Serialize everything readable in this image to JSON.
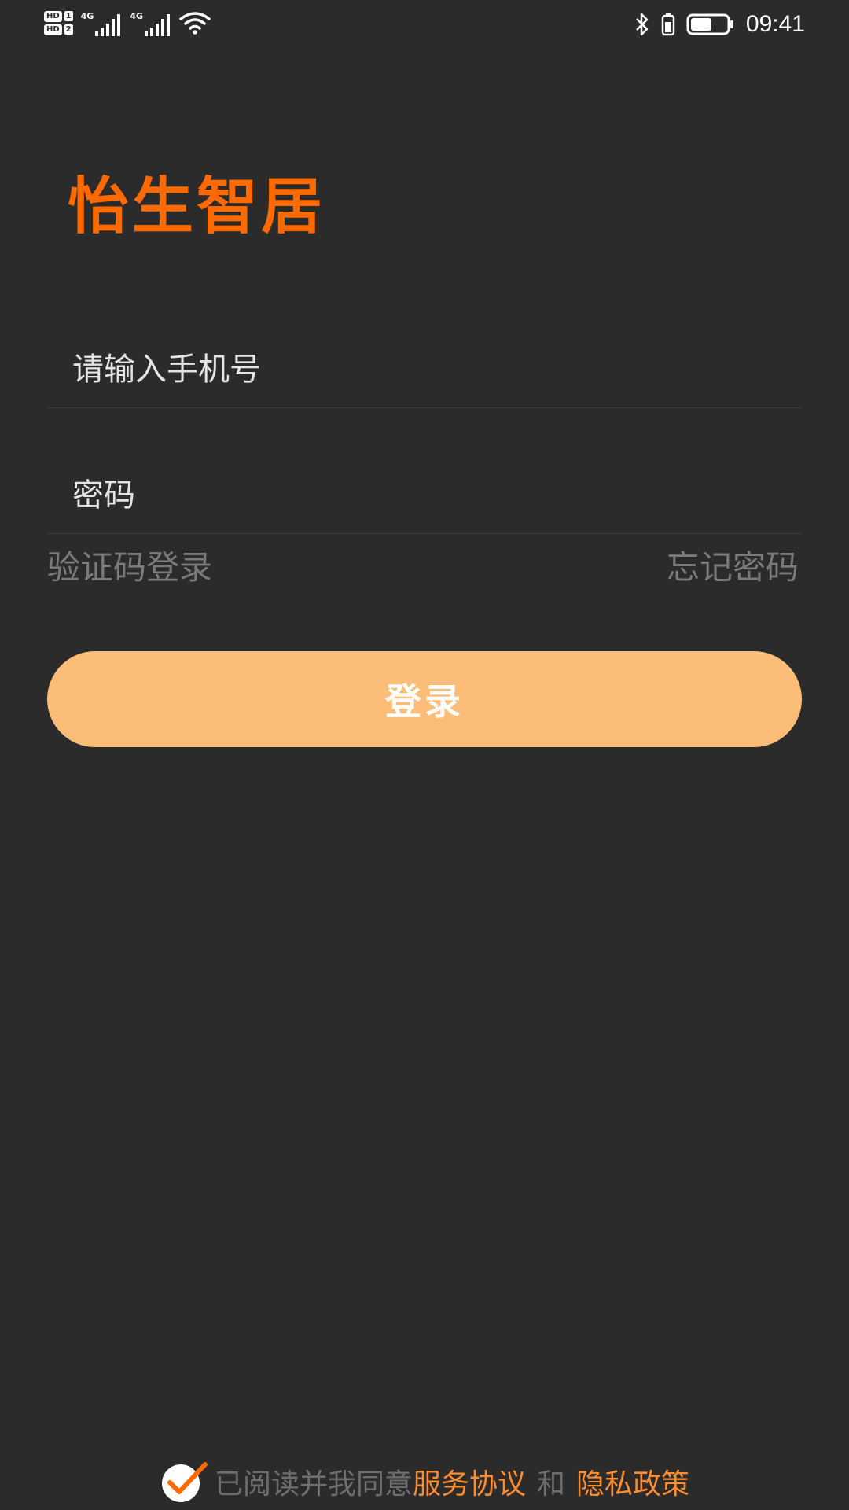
{
  "status_bar": {
    "sim1_badge": "HD",
    "sim1_num": "1",
    "sim2_badge": "HD",
    "sim2_num": "2",
    "net1_label": "4G",
    "net2_label": "4G",
    "time": "09:41",
    "battery_level": 0.6,
    "icons": [
      "hd-sim-icon",
      "cell-signal-icon",
      "cell-signal-icon",
      "wifi-icon",
      "bluetooth-icon",
      "phone-battery-icon",
      "battery-icon"
    ]
  },
  "app": {
    "title": "怡生智居",
    "accent_color": "#ff6a00"
  },
  "form": {
    "phone_placeholder": "请输入手机号",
    "phone_value": "",
    "password_placeholder": "密码",
    "password_value": "",
    "sms_login_label": "验证码登录",
    "forgot_password_label": "忘记密码",
    "login_label": "登录",
    "login_button_color": "#fcbd79"
  },
  "agreement": {
    "checked": true,
    "prefix": "已阅读并我同意",
    "service_label": "服务协议",
    "and_label": "和",
    "privacy_label": "隐私政策",
    "link_color": "#ff8c2e"
  }
}
